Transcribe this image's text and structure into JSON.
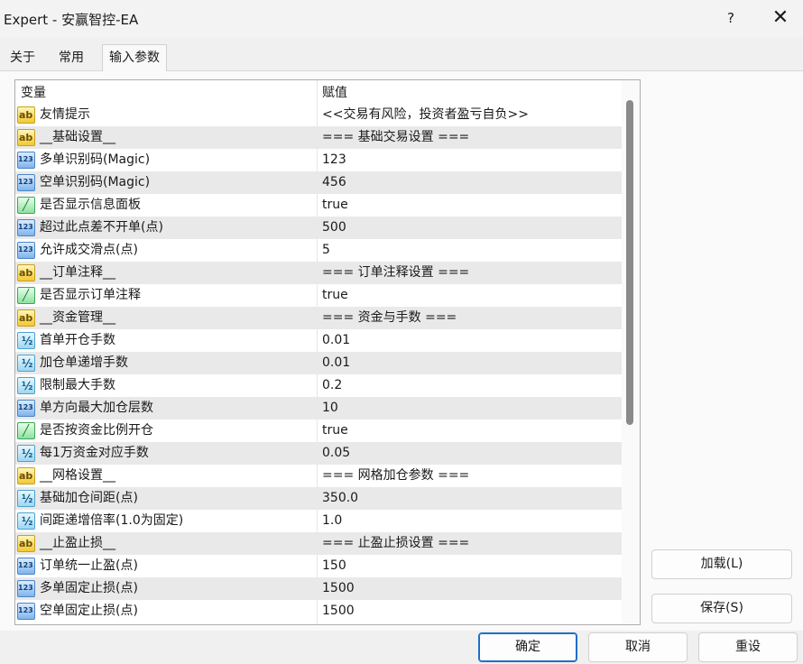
{
  "window": {
    "title": "Expert - 安赢智控-EA",
    "help_label": "?",
    "close_label": "✕"
  },
  "tabs": [
    {
      "label": "关于"
    },
    {
      "label": "常用"
    },
    {
      "label": "输入参数"
    }
  ],
  "active_tab": "输入参数",
  "grid": {
    "columns": [
      "变量",
      "赋值"
    ],
    "rows": [
      {
        "type": "str",
        "name": "友情提示",
        "value": "<<交易有风险，投资者盈亏自负>>"
      },
      {
        "type": "str",
        "name": "__基础设置__",
        "value": "=== 基础交易设置 ==="
      },
      {
        "type": "int",
        "name": "多单识别码(Magic)",
        "value": "123"
      },
      {
        "type": "int",
        "name": "空单识别码(Magic)",
        "value": "456"
      },
      {
        "type": "bool",
        "name": "是否显示信息面板",
        "value": "true"
      },
      {
        "type": "int",
        "name": "超过此点差不开单(点)",
        "value": "500"
      },
      {
        "type": "int",
        "name": "允许成交滑点(点)",
        "value": "5"
      },
      {
        "type": "str",
        "name": "__订单注释__",
        "value": "=== 订单注释设置 ==="
      },
      {
        "type": "bool",
        "name": "是否显示订单注释",
        "value": "true"
      },
      {
        "type": "str",
        "name": "__资金管理__",
        "value": "=== 资金与手数 ==="
      },
      {
        "type": "dbl",
        "name": "首单开仓手数",
        "value": "0.01"
      },
      {
        "type": "dbl",
        "name": "加仓单递增手数",
        "value": "0.01"
      },
      {
        "type": "dbl",
        "name": "限制最大手数",
        "value": "0.2"
      },
      {
        "type": "int",
        "name": "单方向最大加仓层数",
        "value": "10"
      },
      {
        "type": "bool",
        "name": "是否按资金比例开仓",
        "value": "true"
      },
      {
        "type": "dbl",
        "name": "每1万资金对应手数",
        "value": "0.05"
      },
      {
        "type": "str",
        "name": "__网格设置__",
        "value": "=== 网格加仓参数 ==="
      },
      {
        "type": "dbl",
        "name": "基础加仓间距(点)",
        "value": "350.0"
      },
      {
        "type": "dbl",
        "name": "间距递增倍率(1.0为固定)",
        "value": "1.0"
      },
      {
        "type": "str",
        "name": "__止盈止损__",
        "value": "=== 止盈止损设置 ==="
      },
      {
        "type": "int",
        "name": "订单统一止盈(点)",
        "value": "150"
      },
      {
        "type": "int",
        "name": "多单固定止损(点)",
        "value": "1500"
      },
      {
        "type": "int",
        "name": "空单固定止损(点)",
        "value": "1500"
      }
    ]
  },
  "side_buttons": {
    "load": "加载(L)",
    "save": "保存(S)"
  },
  "bottom_buttons": {
    "ok": "确定",
    "cancel": "取消",
    "reset": "重设"
  }
}
